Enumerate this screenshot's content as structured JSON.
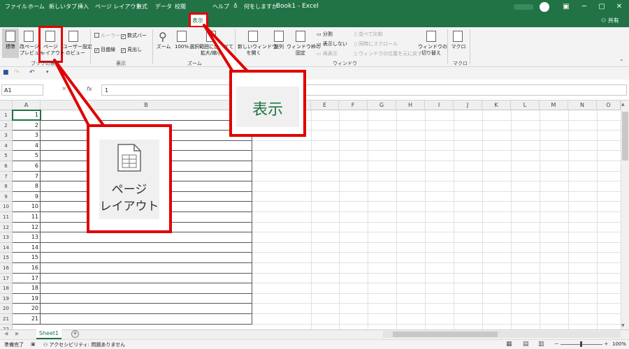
{
  "window": {
    "title": "Book1 - Excel",
    "controls": [
      "─",
      "▢",
      "✕"
    ]
  },
  "menu": {
    "tabs": [
      "ファイル",
      "ホーム",
      "新しいタブ",
      "挿入",
      "ページ レイアウト",
      "数式",
      "データ",
      "校閲",
      "表示",
      "ヘルプ"
    ],
    "search": "何をしますか",
    "share": "共有"
  },
  "ribbon": {
    "book_views": {
      "label": "ブックの表示",
      "normal": "標準",
      "page_break_1": "改ページ",
      "page_break_2": "プレビュー",
      "page_layout_1": "ページ",
      "page_layout_2": "レイアウト",
      "custom_1": "ユーザー設定",
      "custom_2": "のビュー"
    },
    "show": {
      "label": "表示",
      "ruler": "ルーラー",
      "formula_bar": "数式バー",
      "gridlines": "目盛線",
      "headings": "見出し"
    },
    "zoom": {
      "label": "ズーム",
      "zoom": "ズーム",
      "zoom100": "100%",
      "selection_1": "選択範囲に合わせて",
      "selection_2": "拡大/縮小"
    },
    "window": {
      "label": "ウィンドウ",
      "new_window_1": "新しいウィンドウ",
      "new_window_2": "を開く",
      "arrange": "整列",
      "freeze_1": "ウィンドウ枠の",
      "freeze_2": "固定",
      "split": "分割",
      "hide": "表示しない",
      "unhide": "再表示",
      "side_by_side": "並べて比較",
      "sync_scroll": "同時にスクロール",
      "reset_pos": "ウィンドウの位置を元に戻す",
      "switch_1": "ウィンドウの",
      "switch_2": "切り替え"
    },
    "macros": {
      "label": "マクロ",
      "macro": "マクロ"
    }
  },
  "formula": {
    "name_box": "A1",
    "value": "1",
    "fx": "fx"
  },
  "columns": [
    "A",
    "B",
    "E",
    "F",
    "G",
    "H",
    "I",
    "J",
    "K",
    "L",
    "M",
    "N",
    "O"
  ],
  "rows": [
    1,
    2,
    3,
    4,
    5,
    6,
    7,
    8,
    9,
    10,
    11,
    12,
    13,
    14,
    15,
    16,
    17,
    18,
    19,
    20,
    21,
    22
  ],
  "sheet": {
    "tab": "Sheet1",
    "add": "+"
  },
  "status": {
    "ready": "準備完了",
    "accessibility": "アクセシビリティ: 問題ありません",
    "zoom": "100%"
  },
  "callouts": {
    "view_tab": "表示",
    "page_layout_1": "ページ",
    "page_layout_2": "レイアウト"
  },
  "colors": {
    "excel_green": "#217346",
    "highlight_red": "#e00000"
  }
}
